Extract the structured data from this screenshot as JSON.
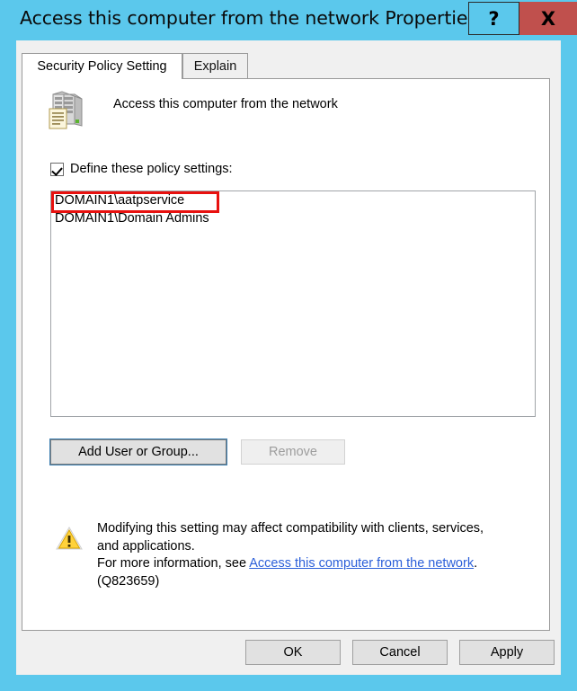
{
  "window": {
    "title": "Access this computer from the network Properties",
    "accent_color": "#5bc8ec",
    "close_color": "#c0504d",
    "help_label": "?",
    "close_label": "X"
  },
  "tabs": [
    {
      "label": "Security Policy Setting",
      "active": true
    },
    {
      "label": "Explain",
      "active": false
    }
  ],
  "policy": {
    "name": "Access this computer from the network",
    "icon": "server-policy-icon"
  },
  "define_checkbox": {
    "label": "Define these policy settings:",
    "checked": true
  },
  "list": {
    "items": [
      {
        "text": "DOMAIN1\\aatpservice",
        "highlighted": true
      },
      {
        "text": "DOMAIN1\\Domain Admins",
        "highlighted": false
      }
    ]
  },
  "annotation": {
    "color": "#e8110f",
    "target": "DOMAIN1\\aatpservice"
  },
  "list_buttons": {
    "add_label": "Add User or Group...",
    "remove_label": "Remove",
    "remove_enabled": false
  },
  "warning": {
    "icon": "warning-triangle-icon",
    "line1": "Modifying this setting may affect compatibility with clients, services,",
    "line2": "and applications.",
    "line3_prefix": "For more information, see ",
    "link_text": "Access this computer from the network",
    "line3_suffix": ".",
    "line4": "(Q823659)",
    "link_color": "#2b5fd9"
  },
  "footer": {
    "ok_label": "OK",
    "cancel_label": "Cancel",
    "apply_label": "Apply"
  }
}
